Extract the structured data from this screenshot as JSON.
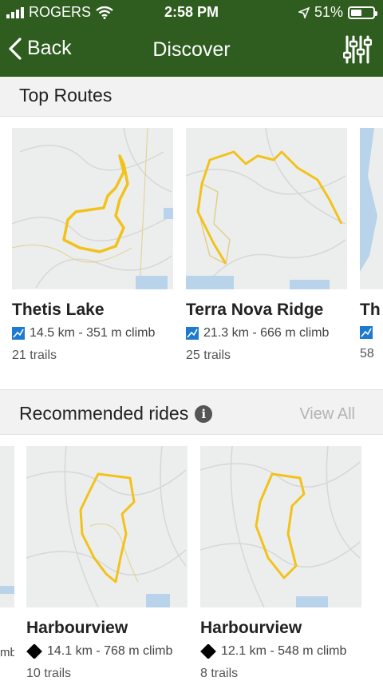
{
  "status_bar": {
    "carrier": "ROGERS",
    "time": "2:58 PM",
    "battery": "51%",
    "battery_level": 0.51
  },
  "nav": {
    "back_label": "Back",
    "title": "Discover"
  },
  "top_routes": {
    "title": "Top Routes",
    "cards": [
      {
        "name": "Thetis Lake",
        "stats": "14.5 km - 351 m climb",
        "trails": "21 trails"
      },
      {
        "name": "Terra Nova Ridge",
        "stats": "21.3 km - 666 m climb",
        "trails": "25 trails"
      },
      {
        "name": "Th",
        "stats": "",
        "trails": "58"
      }
    ]
  },
  "recommended": {
    "title": "Recommended rides",
    "view_all": "View All",
    "cards": [
      {
        "name": "",
        "stats": "mb",
        "trails": ""
      },
      {
        "name": "Harbourview",
        "stats": "14.1 km - 768 m climb",
        "trails": "10 trails"
      },
      {
        "name": "Harbourview",
        "stats": "12.1 km - 548 m climb",
        "trails": "8 trails"
      }
    ]
  },
  "colors": {
    "header": "#2e5d1f",
    "route": "#f2c21b",
    "water": "#b8d3ea",
    "metric_icon": "#1e7ad1"
  },
  "icons": {
    "back": "chevron-left-icon",
    "filter": "sliders-icon",
    "info": "info-icon",
    "route_metric": "chart-icon",
    "difficulty": "black-diamond-icon"
  }
}
